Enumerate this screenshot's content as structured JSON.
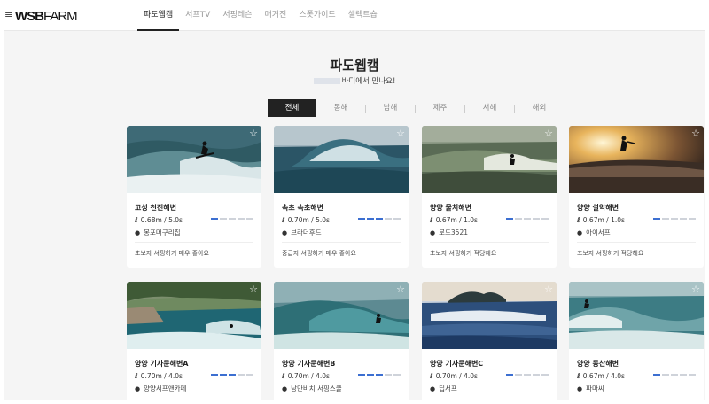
{
  "header": {
    "logo_bold": "WSB",
    "logo_thin": "FARM",
    "menu_icon": "hamburger-icon",
    "nav": [
      "파도웹캠",
      "서프TV",
      "서핑레슨",
      "매거진",
      "스폿가이드",
      "셀렉트숍"
    ],
    "active_nav": "파도웹캠"
  },
  "page": {
    "title": "파도웹캠",
    "subtitle": "바디에서 만나요!"
  },
  "filters": {
    "tabs": [
      "전체",
      "동해",
      "남해",
      "제주",
      "서해",
      "해외"
    ],
    "active": "전체"
  },
  "colors": {
    "level_on": "#3c6fd1",
    "level_off": "#cfd3da",
    "active_tab_bg": "#222222"
  },
  "cards": [
    {
      "name": "고성 천진해변",
      "wave": "0.68m / 5.0s",
      "level": 1,
      "location": "봉포머구리집",
      "desc": "초보자 서핑하기 매우 좋아요",
      "star_icon": "star-outline-icon"
    },
    {
      "name": "속초 속초해변",
      "wave": "0.70m / 5.0s",
      "level": 3,
      "location": "브라더후드",
      "desc": "중급자 서핑하기 매우 좋아요",
      "star_icon": "star-outline-icon"
    },
    {
      "name": "양양 물치해변",
      "wave": "0.67m / 1.0s",
      "level": 1,
      "location": "로드3521",
      "desc": "초보자 서핑하기 적당해요",
      "star_icon": "star-outline-icon"
    },
    {
      "name": "양양 설악해변",
      "wave": "0.67m / 1.0s",
      "level": 1,
      "location": "아이서프",
      "desc": "초보자 서핑하기 적당해요",
      "star_icon": "star-outline-icon"
    },
    {
      "name": "양양 기사문해변A",
      "wave": "0.70m / 4.0s",
      "level": 3,
      "location": "양양서프앤카페",
      "star_icon": "star-outline-icon"
    },
    {
      "name": "양양 기사문해변B",
      "wave": "0.70m / 4.0s",
      "level": 3,
      "location": "낭만비치 서핑스쿨",
      "star_icon": "star-outline-icon"
    },
    {
      "name": "양양 기사문해변C",
      "wave": "0.70m / 4.0s",
      "level": 1,
      "location": "딥서프",
      "star_icon": "star-outline-icon"
    },
    {
      "name": "양양 동산해변",
      "wave": "0.67m / 4.0s",
      "level": 1,
      "location": "파마씨",
      "star_icon": "star-outline-icon"
    }
  ]
}
